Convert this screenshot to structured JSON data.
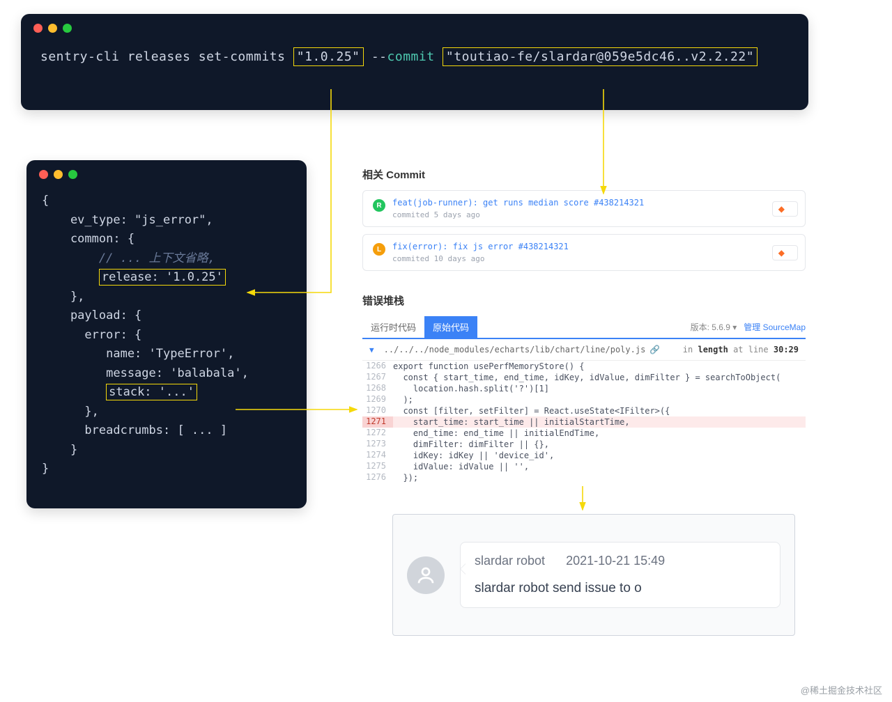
{
  "top_term": {
    "prefix": "sentry-cli releases set-commits",
    "version": "\"1.0.25\"",
    "flag_dashes": "--",
    "flag_commit": "commit",
    "repo_ref": "\"toutiao-fe/slardar@059e5dc46..v2.2.22\""
  },
  "left_term": {
    "l1": "{",
    "l2": "    ev_type: \"js_error\",",
    "l3": "    common: {",
    "l4": "        // ... 上下文省略,",
    "l5_release": "release: '1.0.25'",
    "l6": "    },",
    "l7": "    payload: {",
    "l8": "      error: {",
    "l9": "         name: 'TypeError',",
    "l10": "         message: 'balabala',",
    "l11_stack": "stack: '...'",
    "l12": "      },",
    "l13": "      breadcrumbs: [ ... ]",
    "l14": "    }",
    "l15": "}"
  },
  "related_commit": {
    "heading": "相关 Commit",
    "items": [
      {
        "avatar": "R",
        "title": "feat(job-runner): get runs median score #438214321",
        "meta": "commited 5 days ago"
      },
      {
        "avatar": "L",
        "title": "fix(error): fix js error #438214321",
        "meta": "commited 10 days ago"
      }
    ]
  },
  "stacktrace": {
    "heading": "错误堆栈",
    "tab_runtime": "运行时代码",
    "tab_source": "原始代码",
    "version_label": "版本:",
    "version_value": "5.6.9 ▾",
    "manage_sourcemap": "管理 SourceMap",
    "path": "../../../node_modules/echarts/lib/chart/line/poly.js",
    "location_prefix": "in",
    "location_bold": "length",
    "location_suffix": "at line",
    "location_line": "30:29",
    "code": [
      {
        "ln": "1266",
        "txt": "export function usePerfMemoryStore() {",
        "err": false
      },
      {
        "ln": "1267",
        "txt": "  const { start_time, end_time, idKey, idValue, dimFilter } = searchToObject(",
        "err": false
      },
      {
        "ln": "1268",
        "txt": "    location.hash.split('?')[1]",
        "err": false
      },
      {
        "ln": "1269",
        "txt": "  );",
        "err": false
      },
      {
        "ln": "1270",
        "txt": "  const [filter, setFilter] = React.useState<IFilter>({",
        "err": false
      },
      {
        "ln": "1271",
        "txt": "    start_time: start_time || initialStartTime,",
        "err": true
      },
      {
        "ln": "1272",
        "txt": "    end_time: end_time || initialEndTime,",
        "err": false
      },
      {
        "ln": "1273",
        "txt": "    dimFilter: dimFilter || {},",
        "err": false
      },
      {
        "ln": "1274",
        "txt": "    idKey: idKey || 'device_id',",
        "err": false
      },
      {
        "ln": "1275",
        "txt": "    idValue: idValue || '',",
        "err": false
      },
      {
        "ln": "1276",
        "txt": "  });",
        "err": false
      }
    ]
  },
  "chat": {
    "sender": "slardar robot",
    "time": "2021-10-21 15:49",
    "message": "slardar robot send issue to o"
  },
  "watermark": "@稀土掘金技术社区"
}
